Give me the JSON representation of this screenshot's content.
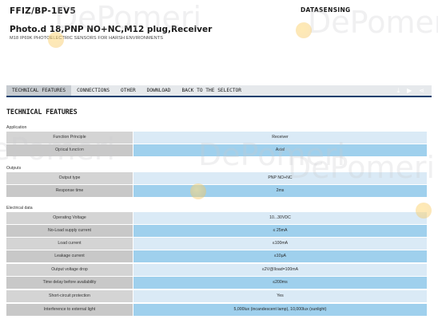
{
  "header": {
    "product_code": "FFIZ/BP-1EV5",
    "brand": "DATASENSING",
    "title": "Photo.d 18,PNP NO+NC,M12 plug,Receiver",
    "subtitle": "M18 IP69K PHOTOELECTRIC SENSORS FOR HARSH ENVIRONMENTS"
  },
  "watermark": {
    "text": "DePomeri"
  },
  "tabs": [
    {
      "label": "TECHNICAL FEATURES",
      "active": true
    },
    {
      "label": "CONNECTIONS"
    },
    {
      "label": "OTHER"
    },
    {
      "label": "DOWNLOAD"
    },
    {
      "label": "BACK TO THE SELECTOR"
    }
  ],
  "actions": {
    "download_icon": "download-icon",
    "video_icon": "video-icon",
    "share_icon": "share-icon"
  },
  "section_title": "TECHNICAL FEATURES",
  "groups": [
    {
      "label": "Application",
      "rows": [
        {
          "key": "Function Principle",
          "value": "Receiver"
        },
        {
          "key": "Optical function",
          "value": "Axial"
        }
      ]
    },
    {
      "label": "Outputs",
      "rows": [
        {
          "key": "Output type",
          "value": "PNP NO+NC"
        },
        {
          "key": "Response time",
          "value": "2ms"
        }
      ]
    },
    {
      "label": "Electrical data",
      "rows": [
        {
          "key": "Operating Voltage",
          "value": "10...30VDC"
        },
        {
          "key": "No-Load supply current",
          "value": "≤ 25mA"
        },
        {
          "key": "Load current",
          "value": "≤100mA"
        },
        {
          "key": "Leakage current",
          "value": "≤10μA"
        },
        {
          "key": "Output voltage drop",
          "value": "≤2V@Iload=100mA"
        },
        {
          "key": "Time delay before availability",
          "value": "≤200ms"
        },
        {
          "key": "Short-circuit protection",
          "value": "Yes"
        },
        {
          "key": "Interference to external light",
          "value": "5,000lux (incandescent lamp), 10,000lux (sunlight)"
        }
      ]
    }
  ]
}
